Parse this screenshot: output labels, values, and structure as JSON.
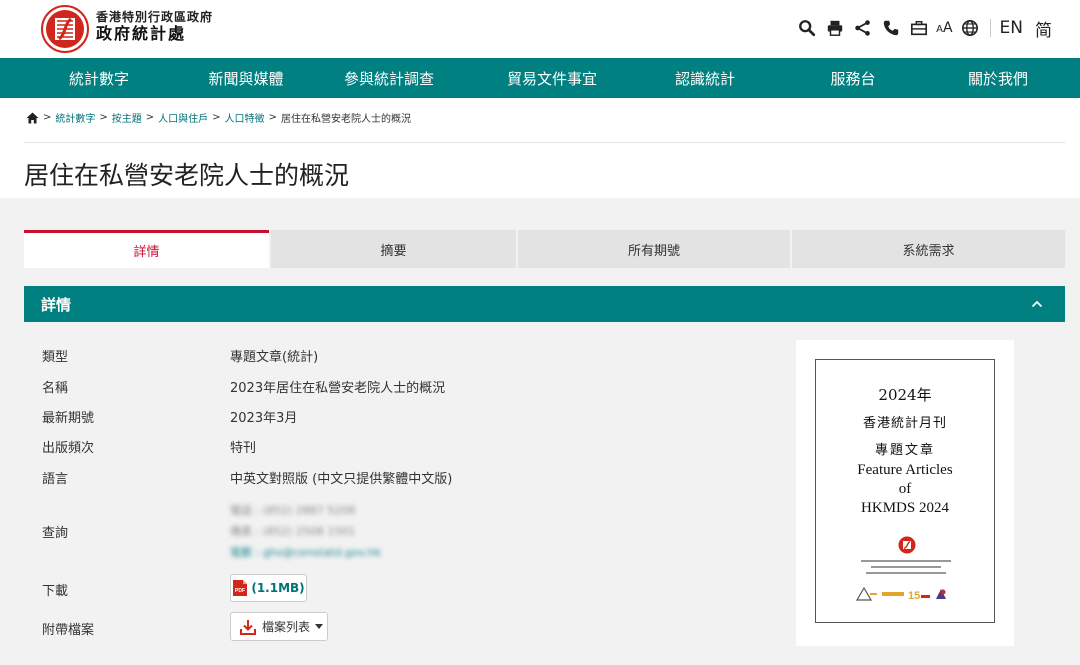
{
  "header": {
    "dept_line1": "香港特別行政區政府",
    "dept_line2": "政府統計處",
    "font_size_label": "AA",
    "lang_en": "EN",
    "lang_sc": "简"
  },
  "nav": {
    "items": [
      "統計數字",
      "新聞與媒體",
      "參與統計調查",
      "貿易文件事宜",
      "認識統計",
      "服務台",
      "關於我們"
    ]
  },
  "breadcrumb": {
    "links": [
      "統計數字",
      "按主題",
      "人口與住戶",
      "人口特徵"
    ],
    "current": "居住在私營安老院人士的概況",
    "separator": ">"
  },
  "page": {
    "title": "居住在私營安老院人士的概況"
  },
  "tabs": [
    {
      "label": "詳情",
      "active": true
    },
    {
      "label": "摘要",
      "active": false
    },
    {
      "label": "所有期號",
      "active": false
    },
    {
      "label": "系統需求",
      "active": false
    }
  ],
  "section": {
    "title": "詳情"
  },
  "details": {
    "type_label": "類型",
    "type_value": "專題文章(統計)",
    "name_label": "名稱",
    "name_value": "2023年居住在私營安老院人士的概況",
    "latest_label": "最新期號",
    "latest_value": "2023年3月",
    "frequency_label": "出版頻次",
    "frequency_value": "特刊",
    "language_label": "語言",
    "language_value": "中英文對照版 (中文只提供繁體中文版)",
    "enquiry_label": "查詢",
    "enquiry_phone": "電話 : (852) 2887 5208",
    "enquiry_fax": "傳真 : (852) 2508 1501",
    "enquiry_email": "電郵 : ghs@censtatd.gov.hk",
    "download_label": "下載",
    "download_size": "(1.1MB)",
    "attachment_label": "附帶檔案",
    "attachment_button": "檔案列表"
  },
  "cover": {
    "line1": "2024年",
    "line2": "香港統計月刊",
    "line3": "專題文章",
    "line4": "Feature Articles",
    "line5": "of",
    "line6": "HKMDS 2024"
  },
  "colors": {
    "brand_teal": "#008080",
    "active_tab_red": "#c8102e",
    "link": "#00727a",
    "pdf_red": "#d0261c"
  }
}
